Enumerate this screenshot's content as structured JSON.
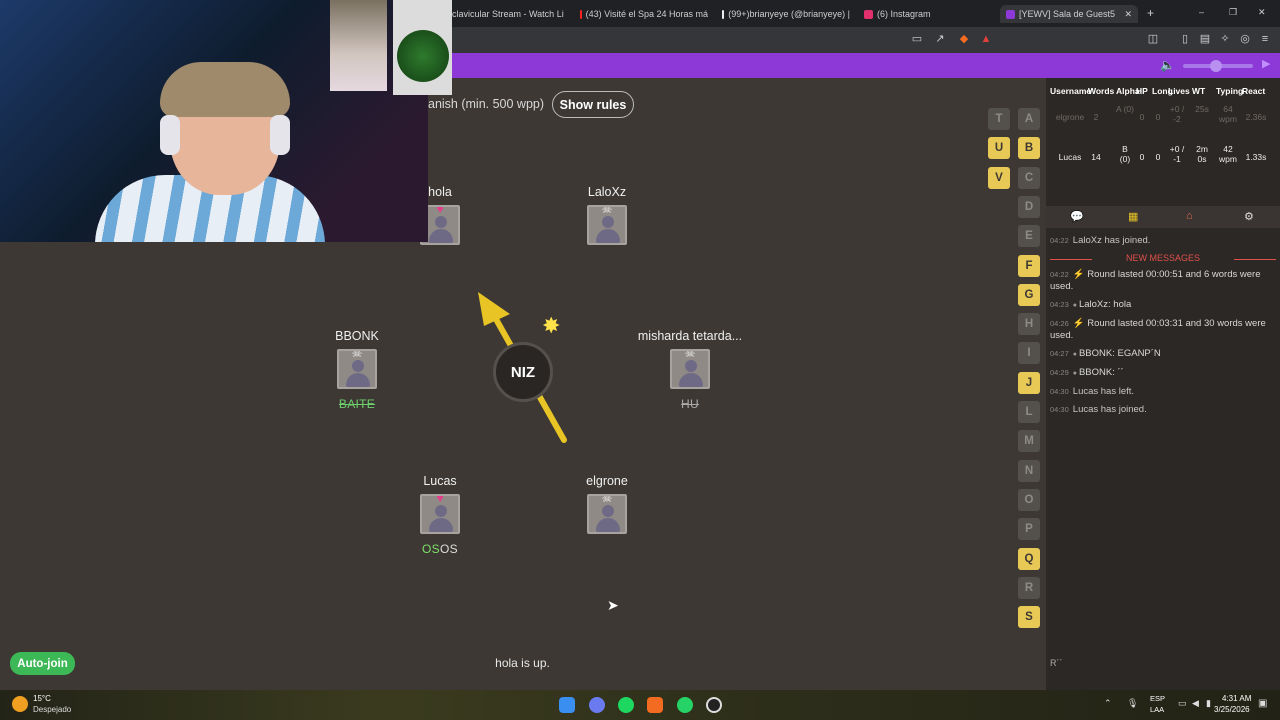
{
  "browser": {
    "tabs": [
      {
        "label": "clavicular Stream - Watch Live",
        "color": "#3aa0ff"
      },
      {
        "label": "(43) Visité el Spa 24 Horas má",
        "color": "#ff2020"
      },
      {
        "label": "(99+)brianyeye (@brianyeye) |",
        "color": "#ffffff"
      },
      {
        "label": "(6) Instagram",
        "color": "#e1306c"
      },
      {
        "label": "[YEWV] Sala de Guest5",
        "color": "#8c39d8"
      }
    ],
    "new_tab_symbol": "+",
    "window_controls": [
      "–",
      "❐",
      "✕"
    ]
  },
  "game": {
    "mode_text": "anish (min. 500 wpp)",
    "rules_button": "Show rules",
    "bomb_syllable": "NIZ",
    "status": "hola is up.",
    "autojoin_label": "Auto-join",
    "players": [
      {
        "name": "hola",
        "badge": "heart",
        "word": ""
      },
      {
        "name": "LaloXz",
        "badge": "skull",
        "word": ""
      },
      {
        "name": "BBONK",
        "badge": "skull",
        "word": "BAITE",
        "word_style": "strike-green"
      },
      {
        "name": "misharda tetarda...",
        "badge": "skull",
        "word": "HU",
        "word_style": "strike"
      },
      {
        "name": "Lucas",
        "badge": "heart",
        "word_hl": "OS",
        "word_rest": "OS"
      },
      {
        "name": "elgrone",
        "badge": "skull",
        "word": ""
      }
    ],
    "letters_left": [
      "T",
      "U",
      "V"
    ],
    "letters_left_state": [
      false,
      true,
      true
    ],
    "letters_right": [
      "A",
      "B",
      "C",
      "D",
      "E",
      "F",
      "G",
      "H",
      "I",
      "J",
      "L",
      "M",
      "N",
      "O",
      "P",
      "Q",
      "R",
      "S"
    ],
    "letters_right_state": [
      false,
      true,
      false,
      false,
      false,
      true,
      true,
      false,
      false,
      true,
      false,
      false,
      false,
      false,
      false,
      true,
      false,
      true
    ]
  },
  "scoreboard": {
    "headers": [
      "Username",
      "Words",
      "Alpha",
      "HP",
      "Long",
      "Lives",
      "WT",
      "Typing",
      "React"
    ],
    "rows": [
      {
        "username": "elgrone",
        "words": "2",
        "alpha": "A (0)",
        "hp": "0",
        "long": "0",
        "lives": "+0 / -2",
        "wt": "25s",
        "typing": "64 wpm",
        "react": "2.36s",
        "dim": true
      },
      {
        "username": "Lucas",
        "words": "14",
        "alpha": "B (0)",
        "hp": "0",
        "long": "0",
        "lives": "+0 / -1",
        "wt": "2m 0s",
        "typing": "42 wpm",
        "react": "1.33s",
        "dim": false
      }
    ]
  },
  "chat": {
    "messages": [
      {
        "ts": "04:22",
        "text": "LaloXz has joined.",
        "type": "sys"
      },
      {
        "type": "new",
        "text": "NEW MESSAGES"
      },
      {
        "ts": "04:22",
        "text": "Round lasted 00:00:51 and 6 words were used.",
        "type": "round"
      },
      {
        "ts": "04:23",
        "text": "LaloXz: hola",
        "type": "user"
      },
      {
        "ts": "04:26",
        "text": "Round lasted 00:03:31 and 30 words were used.",
        "type": "round"
      },
      {
        "ts": "04:27",
        "text": "BBONK: EGANP´N",
        "type": "user"
      },
      {
        "ts": "04:29",
        "text": "BBONK: ´´",
        "type": "user"
      },
      {
        "ts": "04:30",
        "text": "Lucas has left.",
        "type": "sys"
      },
      {
        "ts": "04:30",
        "text": "Lucas has joined.",
        "type": "sys"
      }
    ],
    "input_value": "R´´"
  },
  "taskbar": {
    "weather_temp": "15°C",
    "weather_desc": "Despejado",
    "lang_top": "ESP",
    "lang_bottom": "LAA",
    "time": "4:31 AM",
    "date": "3/25/2026"
  }
}
